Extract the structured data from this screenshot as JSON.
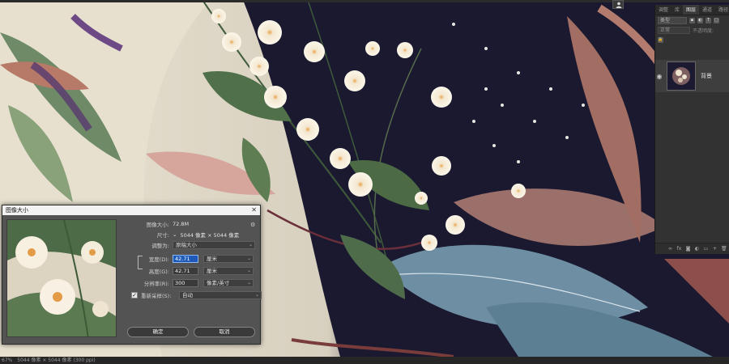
{
  "window": {
    "user_icon": "user-icon"
  },
  "layers_panel": {
    "tabs": [
      "调整",
      "库",
      "图层",
      "通道",
      "路径"
    ],
    "active_tab": "图层",
    "kind_label": "类型",
    "blend_mode": "正常",
    "opacity_label": "不透明度:",
    "layer": {
      "name": "背景",
      "visible_icon": "eye-icon"
    },
    "footer_icons": [
      "link-icon",
      "fx-icon",
      "mask-icon",
      "adjustment-icon",
      "group-icon",
      "new-layer-icon",
      "trash-icon"
    ]
  },
  "statusbar": {
    "zoom": "67%",
    "doc_info": "5044 像素 × 5044 像素 (300 ppi)"
  },
  "dialog": {
    "title": "图像大小",
    "image_size_label": "图像大小:",
    "image_size_value": "72.8M",
    "dimensions_label": "尺寸:",
    "dimensions_value": "5044 像素 × 5044 像素",
    "fit_label": "调整为:",
    "fit_value": "原稿大小",
    "width_label": "宽度(D):",
    "width_value": "42.71",
    "width_unit": "厘米",
    "height_label": "高度(G):",
    "height_value": "42.71",
    "height_unit": "厘米",
    "resolution_label": "分辨率(R):",
    "resolution_value": "300",
    "resolution_unit": "像素/英寸",
    "resample_label": "重新采样(S):",
    "resample_value": "自动",
    "resample_checked": true,
    "ok_label": "确定",
    "cancel_label": "取消"
  }
}
